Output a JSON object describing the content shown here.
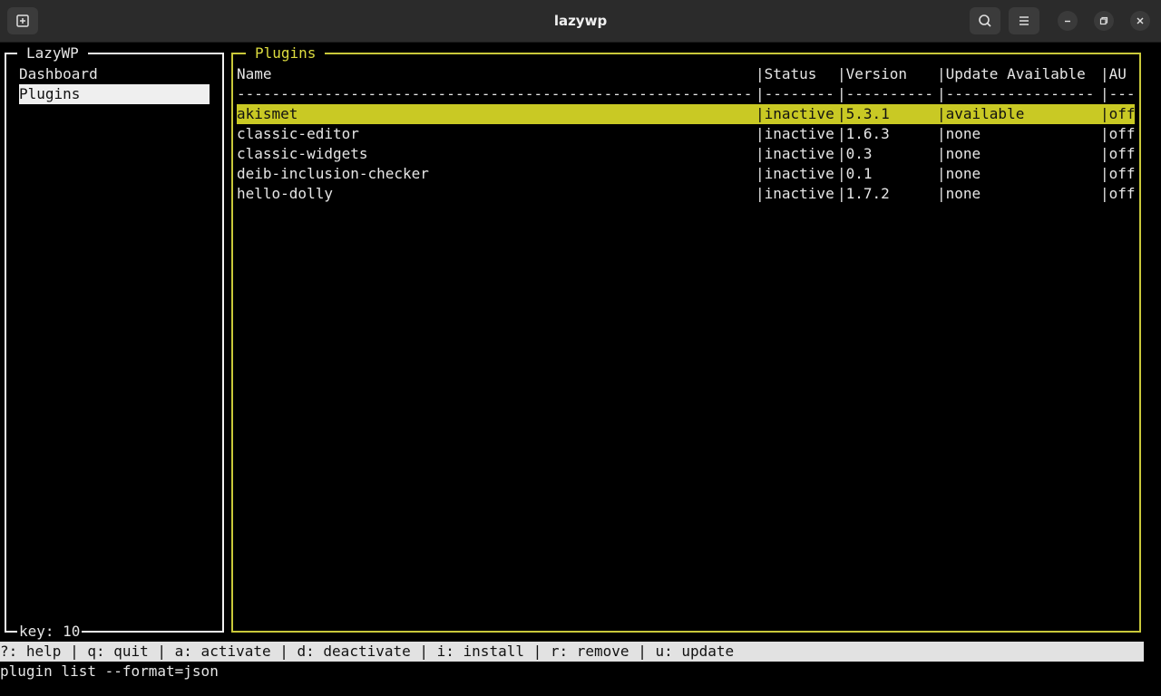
{
  "window": {
    "title": "lazywp"
  },
  "icons": {
    "new_tab": "new-tab-icon",
    "search": "search-icon",
    "menu": "hamburger-menu-icon",
    "minimize": "minimize-icon",
    "maximize": "maximize-icon",
    "close": "close-icon"
  },
  "colors": {
    "accent": "#c9c83a",
    "selection": "#c9c924",
    "statusbar": "#e2e2e2"
  },
  "sidebar": {
    "title": "LazyWP",
    "items": [
      {
        "label": "Dashboard",
        "selected": false
      },
      {
        "label": "Plugins",
        "selected": true
      }
    ],
    "footer": "key: 10"
  },
  "plugins": {
    "title": "Plugins",
    "columns": [
      "Name",
      "|Status",
      "|Version",
      "|Update Available",
      "|AU"
    ],
    "separators": [
      "-----------------------------------------------------------",
      "|--------",
      "|----------",
      "|-----------------",
      "|---"
    ],
    "rows": [
      {
        "name": "akismet",
        "status": "|inactive",
        "version": "|5.3.1",
        "update": "|available",
        "au": "|off"
      },
      {
        "name": "classic-editor",
        "status": "|inactive",
        "version": "|1.6.3",
        "update": "|none",
        "au": "|off"
      },
      {
        "name": "classic-widgets",
        "status": "|inactive",
        "version": "|0.3",
        "update": "|none",
        "au": "|off"
      },
      {
        "name": "deib-inclusion-checker",
        "status": "|inactive",
        "version": "|0.1",
        "update": "|none",
        "au": "|off"
      },
      {
        "name": "hello-dolly",
        "status": "|inactive",
        "version": "|1.7.2",
        "update": "|none",
        "au": "|off"
      }
    ]
  },
  "statusbar": "?: help | q: quit | a: activate | d: deactivate | i: install | r: remove | u: update",
  "command": "plugin list --format=json"
}
